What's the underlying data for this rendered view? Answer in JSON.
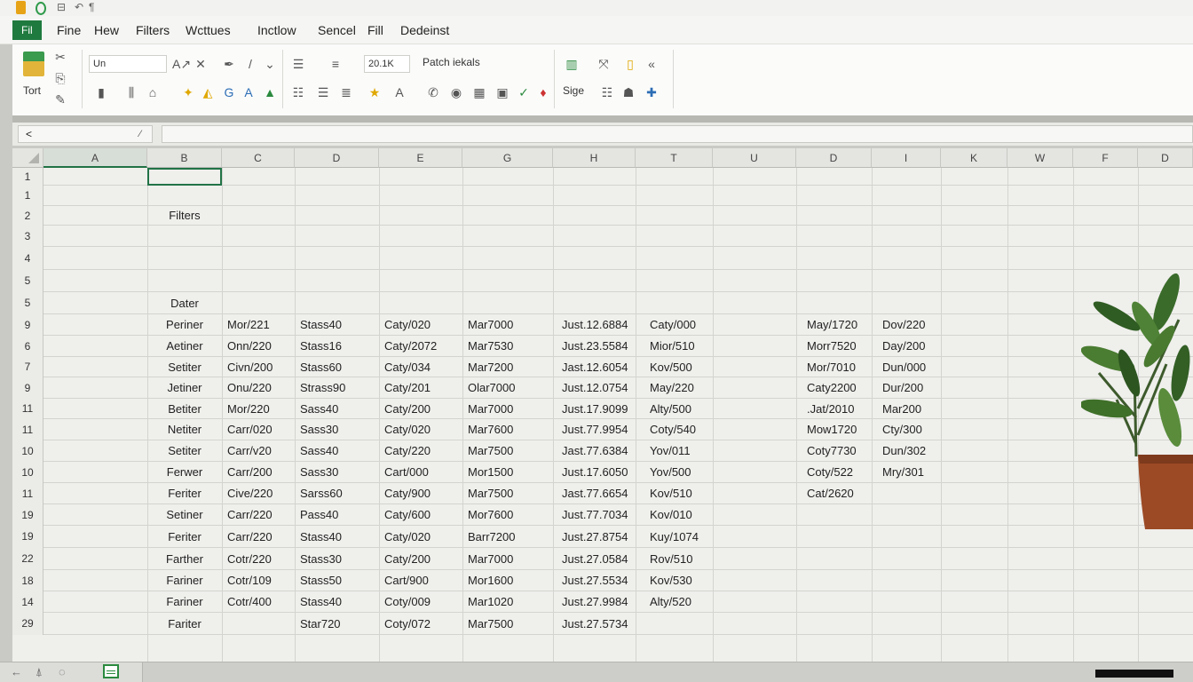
{
  "menu": {
    "active_tab": "Fil",
    "tabs": [
      "Fine",
      "Hew",
      "Filters",
      "Wcttues",
      "Inctlow",
      "Sencel",
      "Fill",
      "Dedeinst"
    ]
  },
  "ribbon": {
    "paste_label": "Tort",
    "font_name": "Un",
    "font_size": "20.1K",
    "group_label": "Patch iekals",
    "style_label": "Sige"
  },
  "formula_bar": {
    "name_box": "<",
    "formula": ""
  },
  "sheet": {
    "columns": [
      "A",
      "B",
      "C",
      "D",
      "E",
      "G",
      "H",
      "T",
      "U",
      "D",
      "I",
      "K",
      "W",
      "F",
      "D"
    ],
    "selected_column": "A",
    "rows": [
      {
        "num": "1",
        "cells": [
          "",
          "",
          "",
          "",
          "",
          "",
          "",
          "",
          "",
          ""
        ]
      },
      {
        "num": "1",
        "cells": [
          "",
          "",
          "",
          "",
          "",
          "",
          "",
          "",
          "",
          ""
        ]
      },
      {
        "num": "2",
        "cells": [
          "Filters",
          "",
          "",
          "",
          "",
          "",
          "",
          "",
          "",
          ""
        ]
      },
      {
        "num": "3",
        "cells": [
          "",
          "",
          "",
          "",
          "",
          "",
          "",
          "",
          "",
          ""
        ]
      },
      {
        "num": "4",
        "cells": [
          "",
          "",
          "",
          "",
          "",
          "",
          "",
          "",
          "",
          ""
        ]
      },
      {
        "num": "5",
        "cells": [
          "",
          "",
          "",
          "",
          "",
          "",
          "",
          "",
          "",
          ""
        ]
      },
      {
        "num": "5",
        "cells": [
          "Dater",
          "",
          "",
          "",
          "",
          "",
          "",
          "",
          "",
          ""
        ]
      },
      {
        "num": "9",
        "cells": [
          "Periner",
          "Mor/221",
          "Stass40",
          "Caty/020",
          "Mar7000",
          "Just.12.6884",
          "Caty/000",
          "",
          "May/1720",
          "Dov/220"
        ]
      },
      {
        "num": "6",
        "cells": [
          "Aetiner",
          "Onn/220",
          "Stass16",
          "Caty/2072",
          "Mar7530",
          "Just.23.5584",
          "Mior/510",
          "",
          "Morr7520",
          "Day/200"
        ]
      },
      {
        "num": "7",
        "cells": [
          "Setiter",
          "Civn/200",
          "Stass60",
          "Caty/034",
          "Mar7200",
          "Jast.12.6054",
          "Kov/500",
          "",
          "Mor/7010",
          "Dun/000"
        ]
      },
      {
        "num": "9",
        "cells": [
          "Jetiner",
          "Onu/220",
          "Strass90",
          "Caty/201",
          "Olar7000",
          "Just.12.0754",
          "May/220",
          "",
          "Caty2200",
          "Dur/200"
        ]
      },
      {
        "num": "11",
        "cells": [
          "Betiter",
          "Mor/220",
          "Sass40",
          "Caty/200",
          "Mar7000",
          "Just.17.9099",
          "Alty/500",
          "",
          ".Jat/2010",
          "Mar200"
        ]
      },
      {
        "num": "11",
        "cells": [
          "Netiter",
          "Carr/020",
          "Sass30",
          "Caty/020",
          "Mar7600",
          "Just.77.9954",
          "Coty/540",
          "",
          "Mow1720",
          "Cty/300"
        ]
      },
      {
        "num": "10",
        "cells": [
          "Setiter",
          "Carr/v20",
          "Sass40",
          "Caty/220",
          "Mar7500",
          "Jast.77.6384",
          "Yov/011",
          "",
          "Coty7730",
          "Dun/302"
        ]
      },
      {
        "num": "10",
        "cells": [
          "Ferwer",
          "Carr/200",
          "Sass30",
          "Cart/000",
          "Mor1500",
          "Just.17.6050",
          "Yov/500",
          "",
          "Coty/522",
          "Mry/301"
        ]
      },
      {
        "num": "11",
        "cells": [
          "Feriter",
          "Cive/220",
          "Sarss60",
          "Caty/900",
          "Mar7500",
          "Jast.77.6654",
          "Kov/510",
          "",
          "Cat/2620",
          ""
        ]
      },
      {
        "num": "19",
        "cells": [
          "Setiner",
          "Carr/220",
          "Pass40",
          "Caty/600",
          "Mor7600",
          "Just.77.7034",
          "Kov/010",
          "",
          "",
          ""
        ]
      },
      {
        "num": "19",
        "cells": [
          "Feriter",
          "Carr/220",
          "Stass40",
          "Caty/020",
          "Barr7200",
          "Just.27.8754",
          "Kuy/1074",
          "",
          "",
          ""
        ]
      },
      {
        "num": "22",
        "cells": [
          "Farther",
          "Cotr/220",
          "Stass30",
          "Caty/200",
          "Mar7000",
          "Just.27.0584",
          "Rov/510",
          "",
          "",
          ""
        ]
      },
      {
        "num": "18",
        "cells": [
          "Fariner",
          "Cotr/109",
          "Stass50",
          "Cart/900",
          "Mor1600",
          "Just.27.5534",
          "Kov/530",
          "",
          "",
          ""
        ]
      },
      {
        "num": "14",
        "cells": [
          "Fariner",
          "Cotr/400",
          "Stass40",
          "Coty/009",
          "Mar1020",
          "Just.27.9984",
          "Alty/520",
          "",
          "",
          ""
        ]
      },
      {
        "num": "29",
        "cells": [
          "Fariter",
          "",
          "Star720",
          "Coty/072",
          "Mar7500",
          "Just.27.5734",
          "",
          "",
          "",
          ""
        ]
      }
    ]
  },
  "colors": {
    "accent": "#1f7a3f",
    "selection": "#217346"
  }
}
